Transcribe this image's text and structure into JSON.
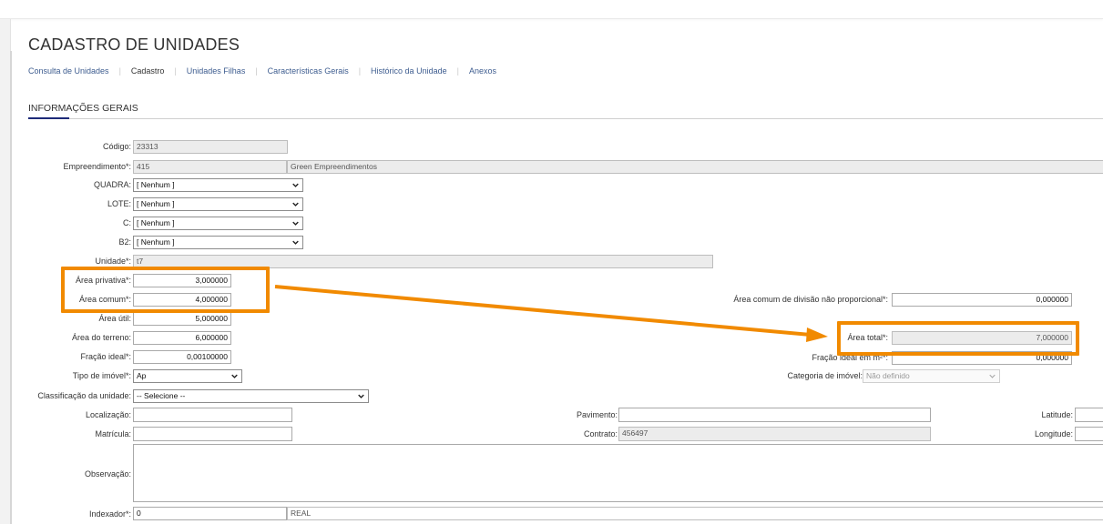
{
  "page": {
    "title": "CADASTRO DE UNIDADES",
    "section_title": "INFORMAÇÕES GERAIS"
  },
  "tabs": [
    {
      "label": "Consulta de Unidades"
    },
    {
      "label": "Cadastro",
      "active": true
    },
    {
      "label": "Unidades Filhas"
    },
    {
      "label": "Características Gerais"
    },
    {
      "label": "Histórico da Unidade"
    },
    {
      "label": "Anexos"
    }
  ],
  "form": {
    "codigo": {
      "label": "Código:",
      "value": "23313"
    },
    "empreendimento": {
      "label": "Empreendimento*:",
      "code": "415",
      "name": "Green Empreendimentos"
    },
    "quadra": {
      "label": "QUADRA:",
      "value": "[ Nenhum ]"
    },
    "lote": {
      "label": "LOTE:",
      "value": "[ Nenhum ]"
    },
    "c": {
      "label": "C:",
      "value": "[ Nenhum ]"
    },
    "b2": {
      "label": "B2:",
      "value": "[ Nenhum ]"
    },
    "unidade": {
      "label": "Unidade*:",
      "value": "t7"
    },
    "area_privativa": {
      "label": "Área privativa*:",
      "value": "3,000000"
    },
    "area_comum": {
      "label": "Área comum*:",
      "value": "4,000000"
    },
    "area_comum_div": {
      "label": "Área comum de divisão não proporcional*:",
      "value": "0,000000"
    },
    "area_util": {
      "label": "Área útil:",
      "value": "5,000000"
    },
    "area_terreno": {
      "label": "Área do terreno:",
      "value": "6,000000"
    },
    "area_total": {
      "label": "Área total*:",
      "value": "7,000000"
    },
    "fracao_ideal": {
      "label": "Fração ideal*:",
      "value": "0,00100000"
    },
    "fracao_ideal_m2": {
      "label": "Fração ideal em m²*:",
      "value": "0,000000"
    },
    "tipo_imovel": {
      "label": "Tipo de imóvel*:",
      "value": "Ap"
    },
    "categoria_imovel": {
      "label": "Categoria de imóvel:",
      "value": "Não definido"
    },
    "classificacao": {
      "label": "Classificação da unidade:",
      "value": "-- Selecione --"
    },
    "localizacao": {
      "label": "Localização:",
      "value": ""
    },
    "pavimento": {
      "label": "Pavimento:",
      "value": ""
    },
    "latitude": {
      "label": "Latitude:",
      "value": ""
    },
    "matricula": {
      "label": "Matrícula:",
      "value": ""
    },
    "contrato": {
      "label": "Contrato:",
      "value": "456497"
    },
    "longitude": {
      "label": "Longitude:",
      "value": ""
    },
    "observacao": {
      "label": "Observação:",
      "value": ""
    },
    "indexador": {
      "label": "Indexador*:",
      "code": "0",
      "name": "REAL"
    }
  },
  "annotation": {
    "color": "#f18a00",
    "icons": [
      "chevron-down-icon",
      "arrow-right-icon"
    ]
  }
}
